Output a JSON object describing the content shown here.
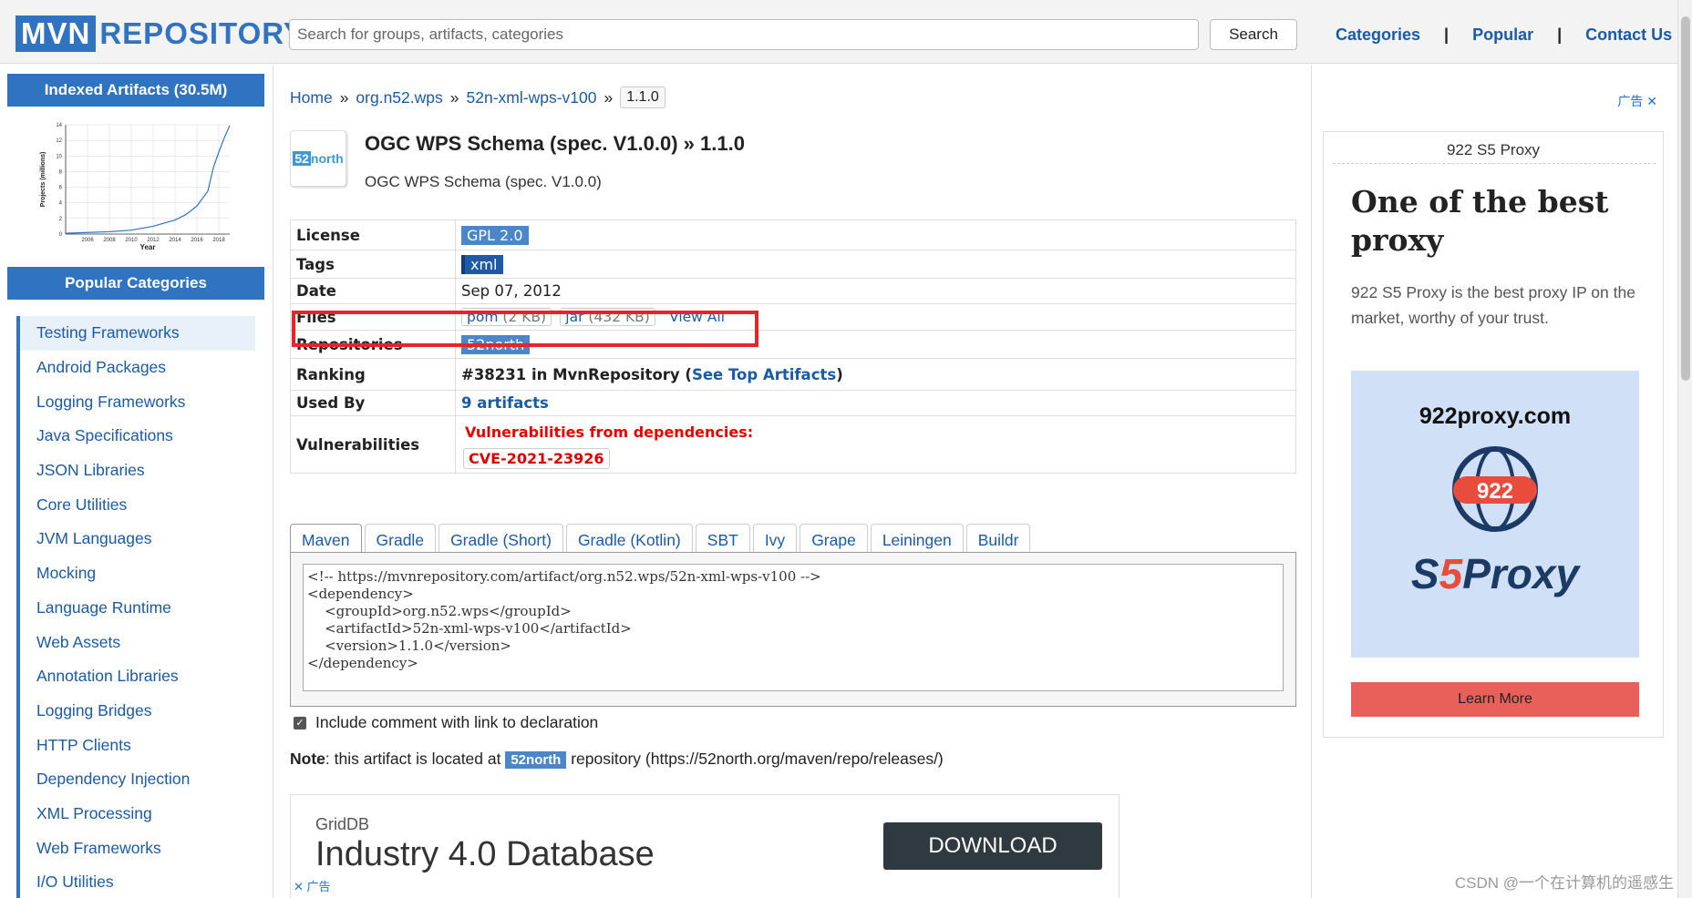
{
  "header": {
    "logo_mvn": "MVN",
    "logo_repo": "REPOSITORY",
    "search_placeholder": "Search for groups, artifacts, categories",
    "search_button": "Search",
    "nav": [
      "Categories",
      "|",
      "Popular",
      "|",
      "Contact Us"
    ]
  },
  "sidebar": {
    "indexed_title": "Indexed Artifacts (30.5M)",
    "chart_data": {
      "type": "line",
      "title": "",
      "xlabel": "Year",
      "ylabel": "Projects (millions)",
      "x": [
        2004,
        2006,
        2008,
        2010,
        2012,
        2014,
        2015,
        2016,
        2017,
        2017.5,
        2018,
        2018.5,
        2019
      ],
      "values": [
        0.1,
        0.2,
        0.3,
        0.5,
        1.0,
        1.8,
        2.5,
        3.6,
        5.5,
        8.5,
        10.5,
        12.3,
        13.9
      ],
      "xticks": [
        "2006",
        "2008",
        "2010",
        "2012",
        "2014",
        "2016",
        "2018"
      ],
      "yticks": [
        "0",
        "2",
        "4",
        "6",
        "8",
        "10",
        "12",
        "14"
      ],
      "ylim": [
        0,
        14
      ],
      "xlim": [
        2004,
        2019
      ],
      "grid": true
    },
    "popular_title": "Popular Categories",
    "categories": [
      "Testing Frameworks",
      "Android Packages",
      "Logging Frameworks",
      "Java Specifications",
      "JSON Libraries",
      "Core Utilities",
      "JVM Languages",
      "Mocking",
      "Language Runtime",
      "Web Assets",
      "Annotation Libraries",
      "Logging Bridges",
      "HTTP Clients",
      "Dependency Injection",
      "XML Processing",
      "Web Frameworks",
      "I/O Utilities"
    ]
  },
  "breadcrumb": {
    "items": [
      "Home",
      "»",
      "org.n52.wps",
      "»",
      "52n-xml-wps-v100",
      "»"
    ],
    "version": "1.1.0"
  },
  "artifact": {
    "logo_prefix": "52",
    "logo_suffix": "north",
    "title": "OGC WPS Schema (spec. V1.0.0) » 1.1.0",
    "subtitle": "OGC WPS Schema (spec. V1.0.0)"
  },
  "info": {
    "license_label": "License",
    "license": "GPL 2.0",
    "tags_label": "Tags",
    "tag": "xml",
    "date_label": "Date",
    "date": "Sep 07, 2012",
    "files_label": "Files",
    "file_pom": "pom",
    "file_pom_size": "(2 KB)",
    "file_jar": "jar",
    "file_jar_size": "(432 KB)",
    "view_all": "View All",
    "repos_label": "Repositories",
    "repo": "52north",
    "ranking_label": "Ranking",
    "ranking_text": "#38231 in MvnRepository (",
    "ranking_link": "See Top Artifacts",
    "ranking_close": ")",
    "usedby_label": "Used By",
    "usedby": "9 artifacts",
    "vuln_label": "Vulnerabilities",
    "vuln_title": "Vulnerabilities from dependencies:",
    "cve": "CVE-2021-23926"
  },
  "tabs": [
    "Maven",
    "Gradle",
    "Gradle (Short)",
    "Gradle (Kotlin)",
    "SBT",
    "Ivy",
    "Grape",
    "Leiningen",
    "Buildr"
  ],
  "code": "<!-- https://mvnrepository.com/artifact/org.n52.wps/52n-xml-wps-v100 -->\n<dependency>\n    <groupId>org.n52.wps</groupId>\n    <artifactId>52n-xml-wps-v100</artifactId>\n    <version>1.1.0</version>\n</dependency>",
  "include_comment": "Include comment with link to declaration",
  "note": {
    "bold": "Note",
    "before": ": this artifact is located at ",
    "repo": "52north",
    "after": " repository (https://52north.org/maven/repo/releases/)"
  },
  "bottom_ad": {
    "brand": "GridDB",
    "headline": "Industry 4.0 Database",
    "button": "DOWNLOAD",
    "ad_tag": "✕ 广告"
  },
  "right_ad": {
    "ad_label": "广告 ✕",
    "brand": "922 S5 Proxy",
    "headline": "One of the best proxy",
    "body": "922 S5 Proxy is the best proxy IP on the market, worthy of your trust.",
    "site": "922proxy.com",
    "badge": "922",
    "logo_s": "S",
    "logo_5": "5",
    "logo_proxy": "Proxy",
    "cta": "Learn More",
    "accent": "#e9605a"
  },
  "watermark": "CSDN @一个在计算机的遥感生"
}
